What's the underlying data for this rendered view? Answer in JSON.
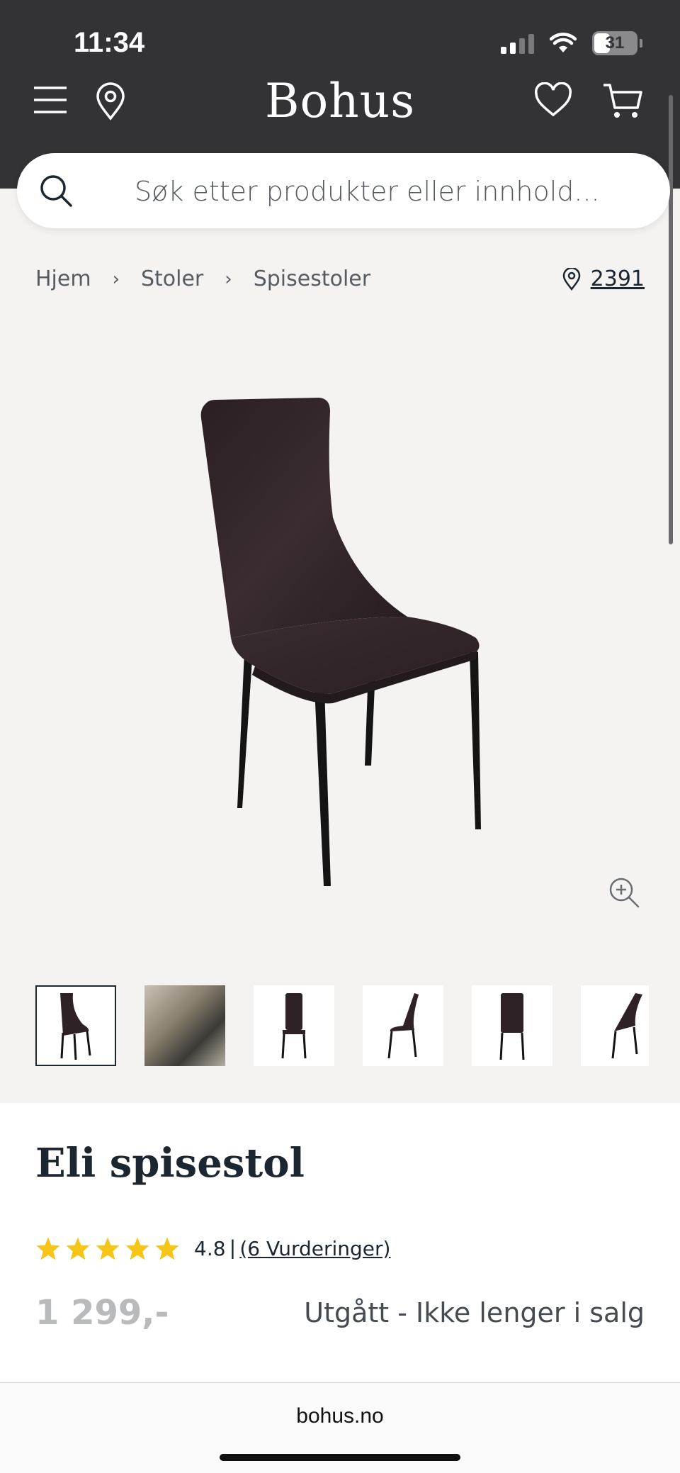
{
  "status_bar": {
    "time": "11:34",
    "battery": "31"
  },
  "header": {
    "logo": "Bohus"
  },
  "search": {
    "placeholder": "Søk etter produkter eller innhold..."
  },
  "breadcrumb": {
    "items": [
      "Hjem",
      "Stoler",
      "Spisestoler"
    ],
    "store": "2391"
  },
  "product": {
    "title": "Eli spisestol",
    "rating": "4.8",
    "rating_separator": "|",
    "rating_count": "(6 Vurderinger)",
    "price": "1 299,-",
    "status": "Utgått - Ikke lenger i salg",
    "stars": 5
  },
  "browser": {
    "url": "bohus.no"
  },
  "colors": {
    "header_bg": "#333336",
    "page_bg": "#f5f3f2",
    "star": "#f5c518",
    "chair": "#2e2226"
  }
}
